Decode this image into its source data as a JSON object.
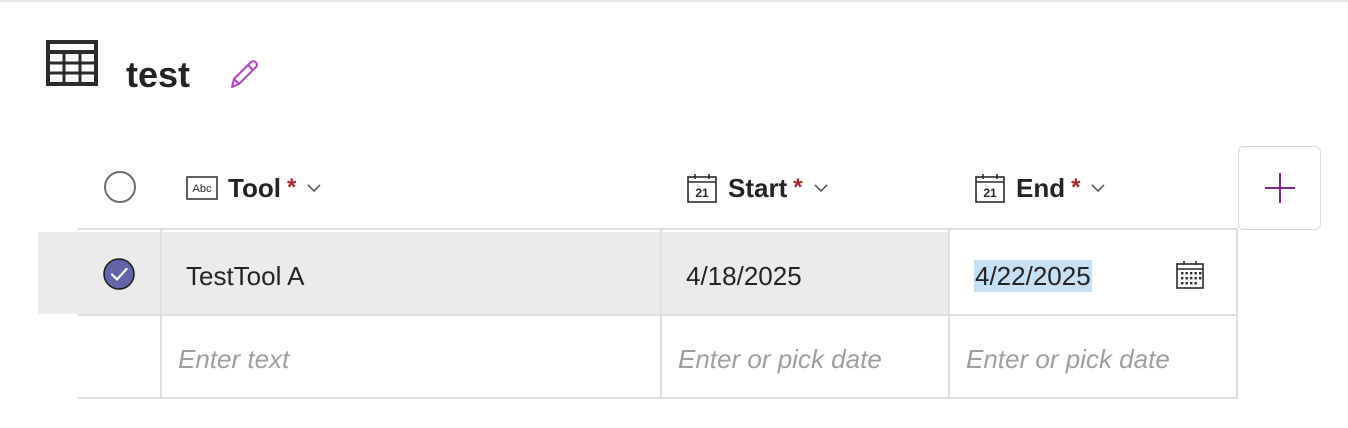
{
  "header": {
    "title": "test",
    "icons": {
      "table": "table-grid-icon",
      "edit": "pencil-icon"
    }
  },
  "columns": [
    {
      "name": "Tool",
      "required_mark": "*",
      "type_icon": "text-field-icon",
      "type_icon_text": "Abc",
      "menu_icon": "chevron-down-icon"
    },
    {
      "name": "Start",
      "required_mark": "*",
      "type_icon": "date-field-icon",
      "type_icon_text": "21",
      "menu_icon": "chevron-down-icon"
    },
    {
      "name": "End",
      "required_mark": "*",
      "type_icon": "date-field-icon",
      "type_icon_text": "21",
      "menu_icon": "chevron-down-icon"
    }
  ],
  "add_column": {
    "icon": "plus-icon"
  },
  "rows": [
    {
      "selected": true,
      "tool": "TestTool A",
      "start": "4/18/2025",
      "end": "4/22/2025"
    }
  ],
  "new_row": {
    "tool_placeholder": "Enter text",
    "start_placeholder": "Enter or pick date",
    "end_placeholder": "Enter or pick date"
  },
  "colors": {
    "accent": "#b146c2",
    "checkbox_fill": "#6264a7",
    "selected_row_bg": "#edebe9",
    "selection_highlight": "#c7e0f4",
    "required": "#a4262c",
    "placeholder": "#a19f9d"
  }
}
